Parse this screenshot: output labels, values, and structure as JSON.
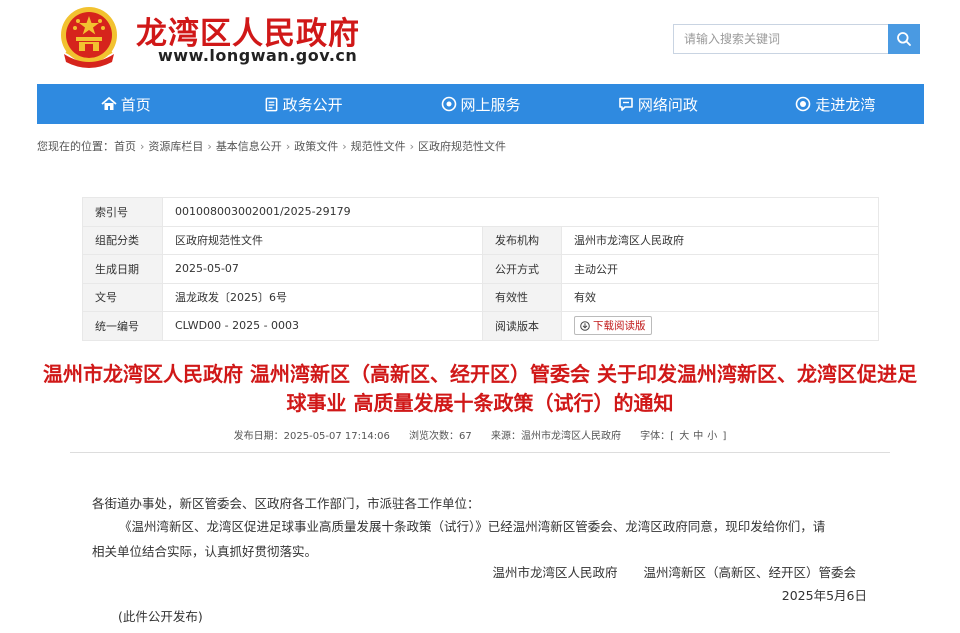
{
  "header": {
    "site_name": "龙湾区人民政府",
    "site_domain": "www.longwan.gov.cn",
    "search_placeholder": "请输入搜索关键词"
  },
  "nav": [
    {
      "label": "首页",
      "icon": "home-icon"
    },
    {
      "label": "政务公开",
      "icon": "document-icon"
    },
    {
      "label": "网上服务",
      "icon": "service-icon"
    },
    {
      "label": "网络问政",
      "icon": "chat-icon"
    },
    {
      "label": "走进龙湾",
      "icon": "eye-icon"
    }
  ],
  "breadcrumb": {
    "prefix": "您现在的位置：",
    "items": [
      "首页",
      "资源库栏目",
      "基本信息公开",
      "政策文件",
      "规范性文件",
      "区政府规范性文件"
    ]
  },
  "info": {
    "index_label": "索引号",
    "index_value": "001008003002001/2025-29179",
    "group_label": "组配分类",
    "group_value": "区政府规范性文件",
    "publisher_label": "发布机构",
    "publisher_value": "温州市龙湾区人民政府",
    "date_label": "生成日期",
    "date_value": "2025-05-07",
    "open_label": "公开方式",
    "open_value": "主动公开",
    "doc_label": "文号",
    "doc_value": "温龙政发〔2025〕6号",
    "valid_label": "有效性",
    "valid_value": "有效",
    "code_label": "统一编号",
    "code_value": "CLWD00 - 2025 - 0003",
    "read_label": "阅读版本",
    "read_button": "下载阅读版"
  },
  "document": {
    "title": "温州市龙湾区人民政府 温州湾新区（高新区、经开区）管委会 关于印发温州湾新区、龙湾区促进足球事业 高质量发展十条政策（试行）的通知",
    "meta": {
      "publish_time": "发布日期：2025-05-07 17:14:06",
      "views": "浏览次数：67",
      "source": "来源：温州市龙湾区人民政府",
      "font_label": "字体：[",
      "font_large": "大",
      "font_medium": "中",
      "font_small": "小",
      "font_end": "]"
    },
    "para1": "各街道办事处，新区管委会、区政府各工作部门，市派驻各工作单位：",
    "para2": "《温州湾新区、龙湾区促进足球事业高质量发展十条政策（试行）》已经温州湾新区管委会、龙湾区政府同意，现印发给你们，请",
    "para3": "相关单位结合实际，认真抓好贯彻落实。",
    "sign1": "温州市龙湾区人民政府",
    "sign2": "温州湾新区（高新区、经开区）管委会",
    "date": "2025年5月6日",
    "note": "(此件公开发布)"
  },
  "colors": {
    "brand_red": "#d01818",
    "nav_blue": "#2f8ae0",
    "search_blue": "#4a9ae2"
  }
}
